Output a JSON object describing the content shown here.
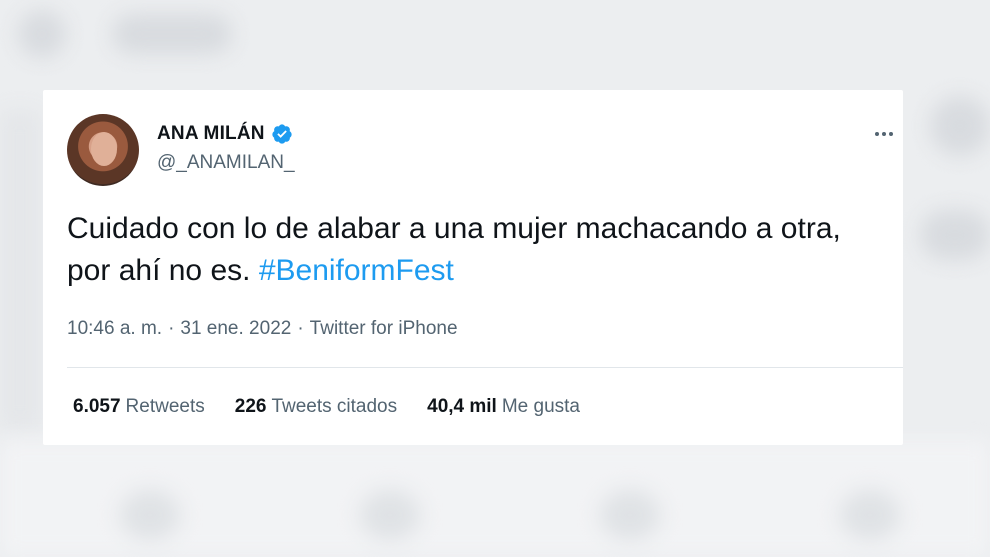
{
  "tweet": {
    "display_name": "ANA MILÁN",
    "handle": "@_ANAMILAN_",
    "verified_icon": "verified-badge-icon",
    "text_plain": "Cuidado con lo de alabar a una mujer machacando a otra, por ahí no es.",
    "hashtag": "#BeniformFest",
    "time": "10:46 a. m.",
    "date": "31 ene. 2022",
    "source": "Twitter for iPhone",
    "meta_separator": "·"
  },
  "stats": [
    {
      "value": "6.057",
      "label": "Retweets"
    },
    {
      "value": "226",
      "label": "Tweets citados"
    },
    {
      "value": "40,4 mil",
      "label": "Me gusta"
    }
  ],
  "colors": {
    "link": "#1d9bf0",
    "verified": "#1d9bf0",
    "text": "#0f1419",
    "secondary": "#536471"
  },
  "icons": {
    "more": "more-options-icon"
  }
}
